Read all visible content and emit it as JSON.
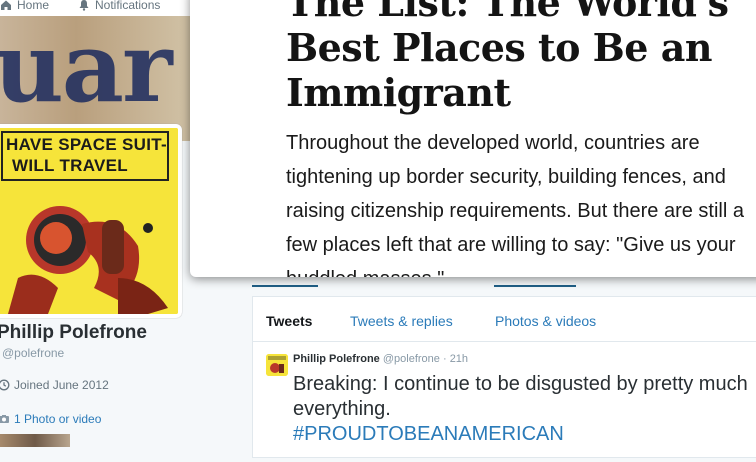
{
  "nav": {
    "home": "Home",
    "notifications": "Notifications"
  },
  "banner": {
    "text": "uar"
  },
  "avatar": {
    "caption_line1": "HAVE SPACE SUIT-",
    "caption_line2": "WILL TRAVEL"
  },
  "profile": {
    "name": "Phillip Polefrone",
    "handle": "@polefrone",
    "joined": "Joined June 2012",
    "media": "1 Photo or video"
  },
  "tabs": [
    "Tweets",
    "Tweets & replies",
    "Photos & videos"
  ],
  "tweet": {
    "name": "Phillip Polefrone",
    "handle": "@polefrone",
    "time": "· 21h",
    "text": "Breaking: I continue to be disgusted by pretty much everything.",
    "hashtag": "#PROUDTOBEANAMERICAN"
  },
  "article": {
    "title": "The List: The World's Best Places to Be an Immigrant",
    "body": "Throughout the developed world, countries are tightening up border security, building fences, and raising citizenship requirements. But there are still a few places left that are willing to say: \"Give us your huddled masses.\""
  },
  "colors": {
    "link": "#2b7bb9",
    "avatar_yellow": "#f6e43a",
    "selection": "#1f5f86"
  }
}
